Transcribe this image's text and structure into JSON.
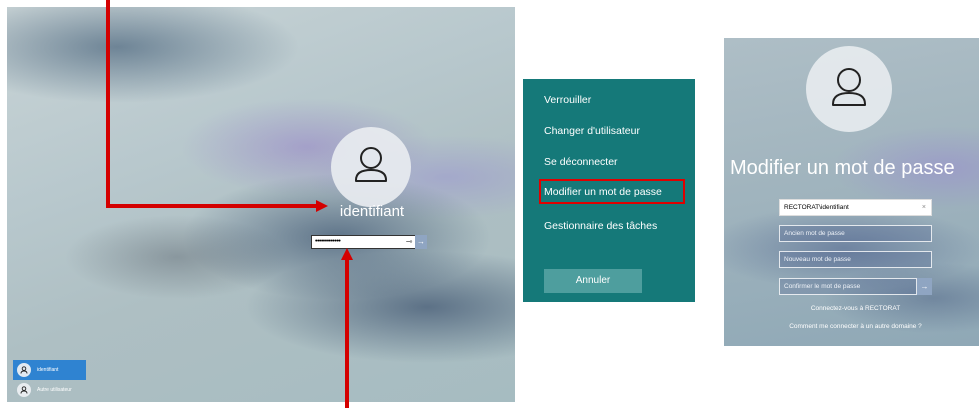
{
  "lock_screen": {
    "username": "identifiant",
    "password_value": "•••••••••••••",
    "reveal_icon": "eye-icon",
    "submit_icon": "arrow-right-icon",
    "user_list": [
      {
        "label": "identifiant",
        "active": true
      },
      {
        "label": "Autre utilisateur",
        "active": false
      }
    ]
  },
  "menu": {
    "items": [
      "Verrouiller",
      "Changer d'utilisateur",
      "Se déconnecter",
      "Modifier un mot de passe",
      "Gestionnaire des tâches"
    ],
    "highlighted_index": 3,
    "cancel_label": "Annuler"
  },
  "change_password": {
    "title": "Modifier un mot de passe",
    "account_value": "RECTORAT\\identifiant",
    "old_password_placeholder": "Ancien mot de passe",
    "new_password_placeholder": "Nouveau mot de passe",
    "confirm_password_placeholder": "Confirmer le mot de passe",
    "domain_hint": "Connectez-vous à RECTORAT",
    "other_domain_link": "Comment me connecter à un autre domaine ?"
  },
  "colors": {
    "annotation_red": "#d40000",
    "menu_background": "#157979",
    "active_user": "#2f83d1"
  }
}
